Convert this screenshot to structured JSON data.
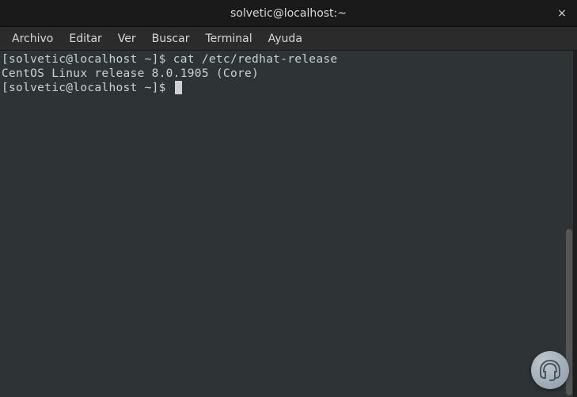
{
  "titlebar": {
    "title": "solvetic@localhost:~",
    "close_glyph": "×"
  },
  "menubar": {
    "items": [
      "Archivo",
      "Editar",
      "Ver",
      "Buscar",
      "Terminal",
      "Ayuda"
    ]
  },
  "terminal": {
    "prompt1": "[solvetic@localhost ~]$ ",
    "command1": "cat /etc/redhat-release",
    "output1": "CentOS Linux release 8.0.1905 (Core)",
    "prompt2": "[solvetic@localhost ~]$ "
  }
}
